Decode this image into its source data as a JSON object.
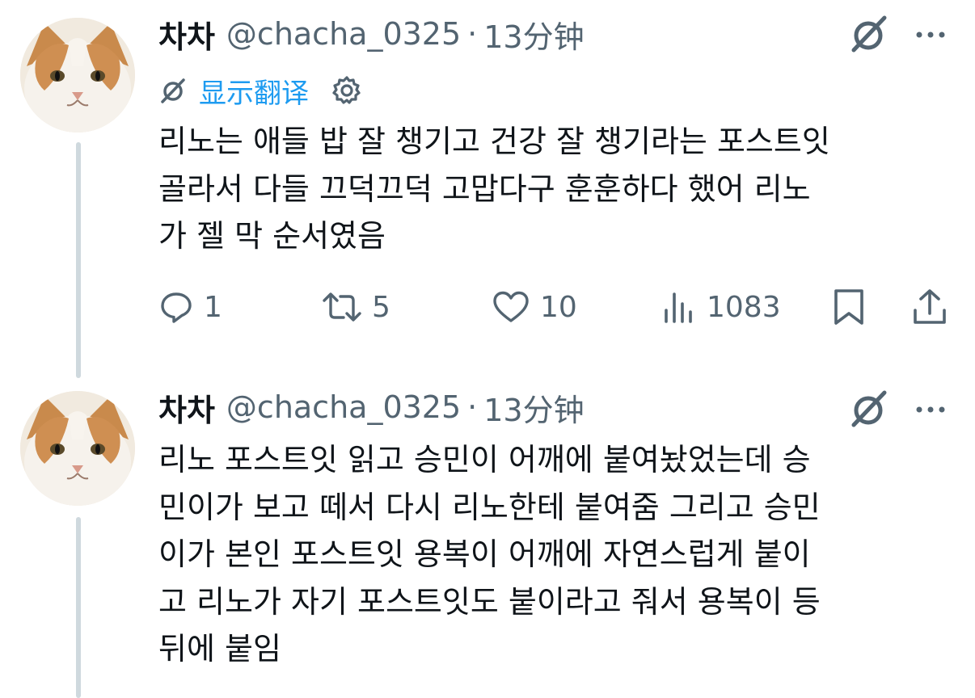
{
  "tweets": [
    {
      "author_name": "차차",
      "handle": "@chacha_0325",
      "separator": "·",
      "time": "13分钟",
      "translate_label": "显示翻译",
      "text": "리노는 애들 밥 잘 챙기고 건강 잘 챙기라는 포스트잇\n골라서 다들 끄덕끄덕 고맙다구 훈훈하다 했어 리노\n가 젤 막 순서였음",
      "replies": "1",
      "retweets": "5",
      "likes": "10",
      "views": "1083"
    },
    {
      "author_name": "차차",
      "handle": "@chacha_0325",
      "separator": "·",
      "time": "13分钟",
      "text": "리노 포스트잇 읽고 승민이 어깨에 붙여놨었는데 승\n민이가 보고 떼서 다시 리노한테 붙여줌 그리고 승민\n이가 본인 포스트잇 용복이 어깨에 자연스럽게 붙이\n고 리노가 자기 포스트잇도 붙이라고 줘서 용복이 등\n뒤에 붙임"
    }
  ],
  "colors": {
    "text": "#0f1419",
    "secondary": "#536471",
    "accent": "#1d9bf0",
    "thread_line": "#cfd9de"
  },
  "icons": [
    "grok-icon",
    "more-icon",
    "translate-icon",
    "gear-icon",
    "reply-icon",
    "retweet-icon",
    "like-icon",
    "views-icon",
    "bookmark-icon",
    "share-icon"
  ]
}
